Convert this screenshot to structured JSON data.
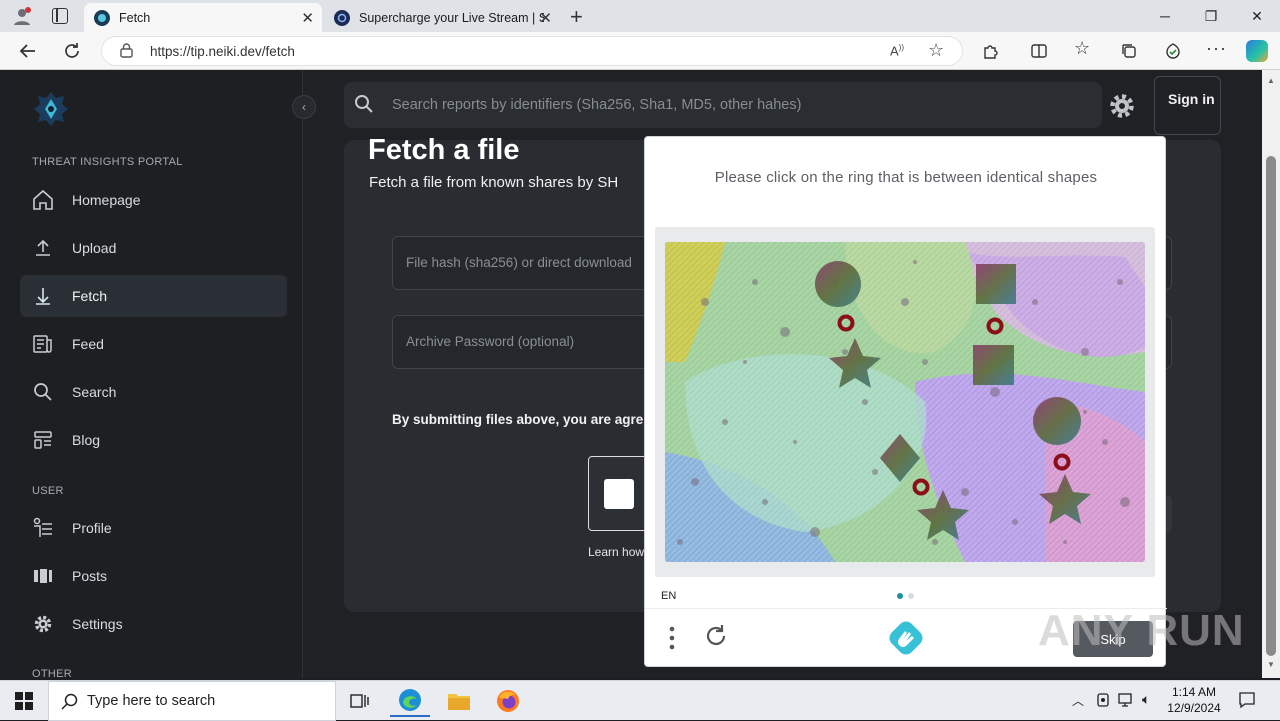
{
  "browser": {
    "tabs": [
      {
        "title": "Fetch",
        "active": true
      },
      {
        "title": "Supercharge your Live Stream | S",
        "active": false
      }
    ],
    "url": "https://tip.neiki.dev/fetch"
  },
  "sidebar": {
    "section_portal": "THREAT INSIGHTS PORTAL",
    "items": [
      {
        "label": "Homepage",
        "icon": "home-icon"
      },
      {
        "label": "Upload",
        "icon": "upload-icon"
      },
      {
        "label": "Fetch",
        "icon": "download-icon"
      },
      {
        "label": "Feed",
        "icon": "feed-icon"
      },
      {
        "label": "Search",
        "icon": "search-icon"
      },
      {
        "label": "Blog",
        "icon": "blog-icon"
      }
    ],
    "section_user": "USER",
    "user_items": [
      {
        "label": "Profile",
        "icon": "profile-icon"
      },
      {
        "label": "Posts",
        "icon": "posts-icon"
      },
      {
        "label": "Settings",
        "icon": "gear-icon"
      }
    ],
    "section_other": "OTHER"
  },
  "header": {
    "search_placeholder": "Search reports by identifiers (Sha256, Sha1, MD5, other hahes)",
    "signin_label": "Sign in"
  },
  "main": {
    "title": "Fetch a file",
    "subtitle": "Fetch a file from known shares by SH",
    "hash_placeholder": "File hash (sha256) or direct download",
    "password_placeholder": "Archive Password (optional)",
    "terms_text": "By submitting files above, you are agre",
    "learn_text": "Learn how"
  },
  "captcha": {
    "prompt": "Please click on the ring that is between identical shapes",
    "language": "EN",
    "skip_label": "Skip"
  },
  "watermark": "ANY RUN",
  "taskbar": {
    "search_placeholder": "Type here to search",
    "time": "1:14 AM",
    "date": "12/9/2024"
  },
  "colors": {
    "accent_teal": "#1b8fa8",
    "app_bg": "#1f2125",
    "panel_bg": "#292c31"
  }
}
